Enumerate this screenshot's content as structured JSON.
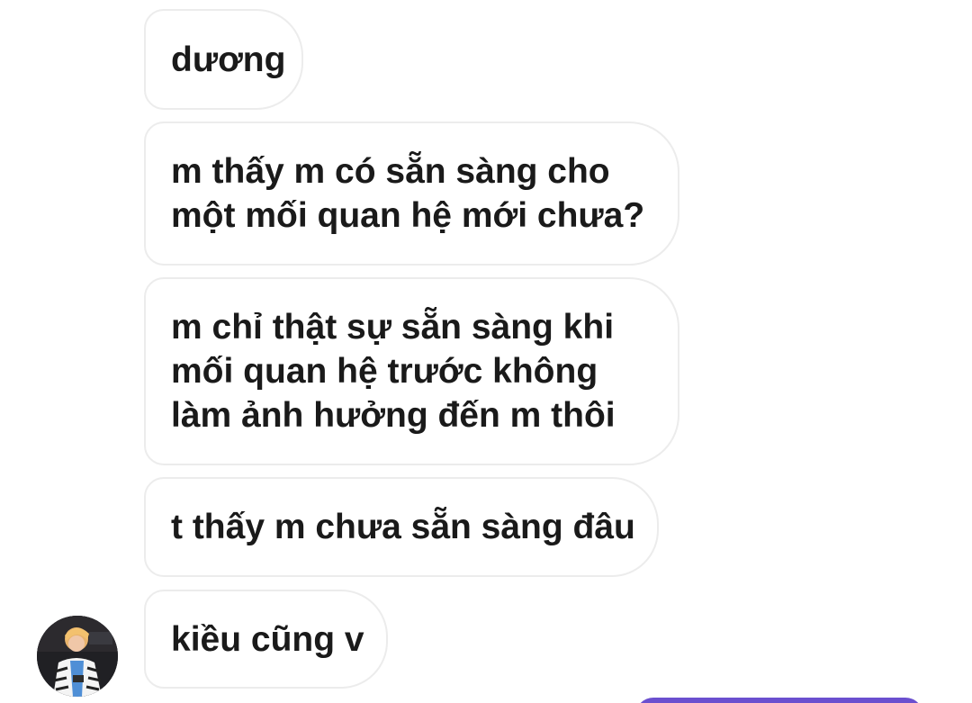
{
  "conversation": {
    "messages": [
      {
        "text": "dương"
      },
      {
        "text": "m thấy m có sẵn sàng cho\nmột mối quan hệ mới chưa?"
      },
      {
        "text": "m chỉ thật sự sẵn sàng khi\nmối quan hệ trước không\nlàm ảnh hưởng đến m thôi"
      },
      {
        "text": "t thấy m chưa sẵn sàng đâu"
      },
      {
        "text": "kiều cũng v"
      }
    ]
  },
  "colors": {
    "incoming_bubble_border": "#ececec",
    "incoming_bubble_bg": "#ffffff",
    "outgoing_bubble": "#6b4fcf",
    "text": "#1a1a1a"
  },
  "icons": {
    "avatar": "contact-avatar"
  }
}
